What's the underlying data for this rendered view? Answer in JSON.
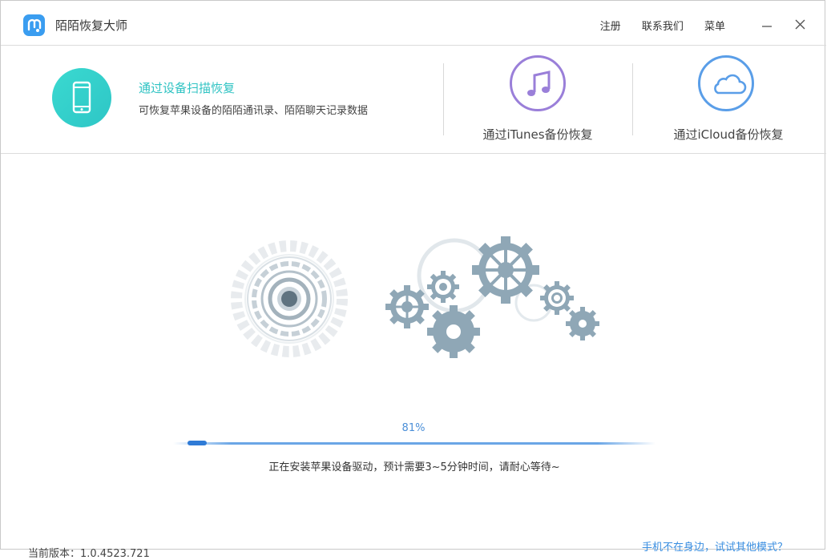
{
  "app": {
    "title": "陌陌恢复大师"
  },
  "header": {
    "links": [
      "注册",
      "联系我们",
      "菜单"
    ]
  },
  "modes": {
    "device": {
      "title": "通过设备扫描恢复",
      "description": "可恢复苹果设备的陌陌通讯录、陌陌聊天记录数据"
    },
    "itunes": {
      "label": "通过iTunes备份恢复"
    },
    "icloud": {
      "label": "通过iCloud备份恢复"
    }
  },
  "progress": {
    "percent_text": "81%",
    "status": "正在安装苹果设备驱动，预计需要3~5分钟时间，请耐心等待~"
  },
  "footer": {
    "version": "当前版本：1.0.4523.721",
    "other_mode_link": "手机不在身边，试试其他模式？"
  },
  "colors": {
    "accent_teal": "#2fc3c3",
    "accent_blue": "#3a8ee0",
    "itunes_purple": "#9a7fd9",
    "gear_gray": "#8fa7b6"
  },
  "icons": [
    "app-logo-icon",
    "minimize-icon",
    "close-icon",
    "phone-icon",
    "music-note-icon",
    "cloud-icon",
    "gears-illustration"
  ]
}
